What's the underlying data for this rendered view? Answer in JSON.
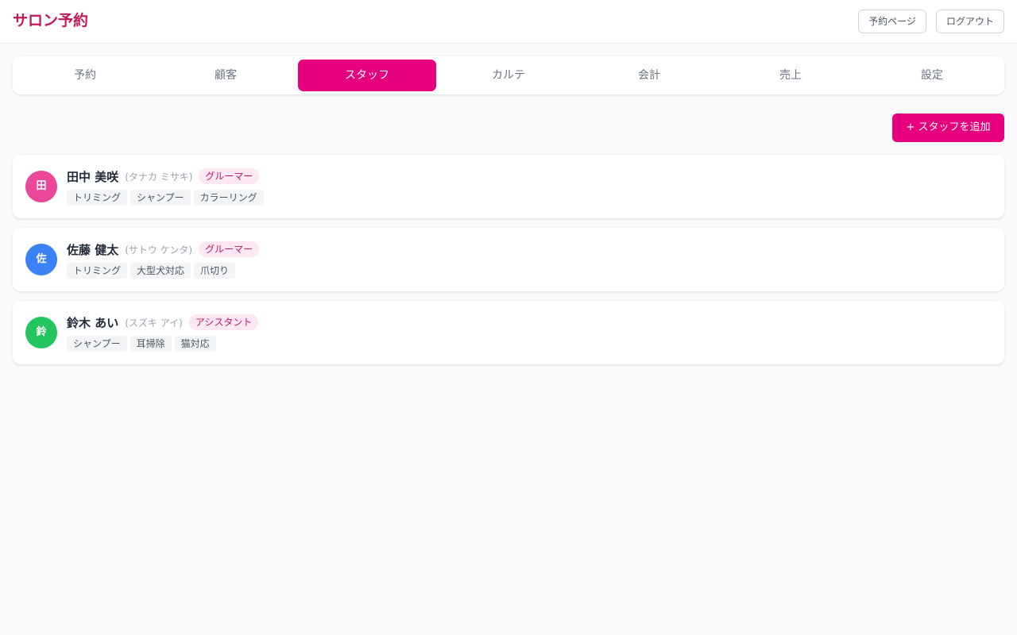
{
  "app": {
    "title": "サロン予約",
    "brand_color": "#c2185b",
    "accent_color": "#e6007e"
  },
  "header": {
    "booking_page_label": "予約ページ",
    "logout_label": "ログアウト"
  },
  "tabs": [
    {
      "label": "予約",
      "active": false
    },
    {
      "label": "顧客",
      "active": false
    },
    {
      "label": "スタッフ",
      "active": true
    },
    {
      "label": "カルテ",
      "active": false
    },
    {
      "label": "会計",
      "active": false
    },
    {
      "label": "売上",
      "active": false
    },
    {
      "label": "設定",
      "active": false
    }
  ],
  "toolbar": {
    "add_staff_label": "+ スタッフを追加"
  },
  "staff": [
    {
      "initial": "田",
      "avatar_color": "#ec4899",
      "name": "田中 美咲",
      "kana": "(タナカ ミサキ)",
      "role": "グルーマー",
      "skills": [
        "トリミング",
        "シャンプー",
        "カラーリング"
      ]
    },
    {
      "initial": "佐",
      "avatar_color": "#3b82f6",
      "name": "佐藤 健太",
      "kana": "(サトウ ケンタ)",
      "role": "グルーマー",
      "skills": [
        "トリミング",
        "大型犬対応",
        "爪切り"
      ]
    },
    {
      "initial": "鈴",
      "avatar_color": "#22c55e",
      "name": "鈴木 あい",
      "kana": "(スズキ アイ)",
      "role": "アシスタント",
      "skills": [
        "シャンプー",
        "耳掃除",
        "猫対応"
      ]
    }
  ],
  "role_badge": {
    "background": "#fce7f3",
    "text_color": "#be185d"
  }
}
